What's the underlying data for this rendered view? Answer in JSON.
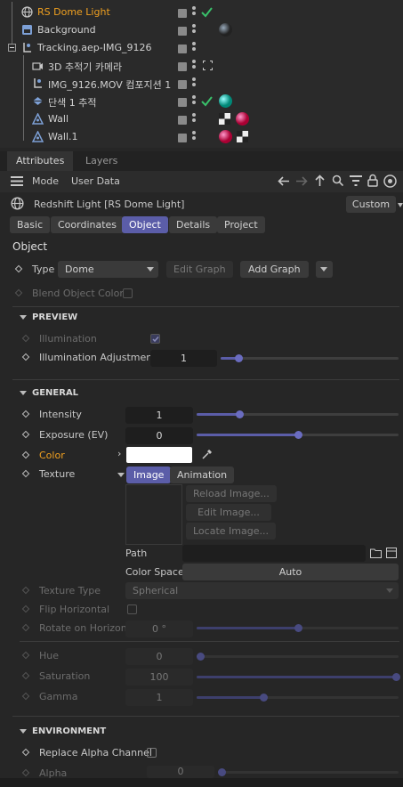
{
  "object_manager": {
    "rows": [
      {
        "name": "RS Dome Light",
        "selected": true
      },
      {
        "name": "Background"
      },
      {
        "name": "Tracking.aep-IMG_9126"
      },
      {
        "name": "3D 추적기 카메라"
      },
      {
        "name": "IMG_9126.MOV 컴포지션 1"
      },
      {
        "name": "단색 1 추적"
      },
      {
        "name": "Wall"
      },
      {
        "name": "Wall.1"
      }
    ]
  },
  "tabs": [
    "Attributes",
    "Layers"
  ],
  "toolbar": {
    "mode_label": "Mode",
    "user_data_label": "User Data"
  },
  "object_header": {
    "title": "Redshift Light [RS Dome Light]",
    "preset": "Custom",
    "tabs": [
      "Basic",
      "Coordinates",
      "Object",
      "Details",
      "Project"
    ],
    "active_tab": "Object",
    "section_title": "Object"
  },
  "type_row": {
    "label": "Type",
    "value": "Dome",
    "edit_graph": "Edit Graph",
    "add_graph": "Add Graph"
  },
  "blend_object_color": "Blend Object Color",
  "preview": {
    "title": "PREVIEW",
    "illumination_label": "Illumination",
    "illumination_adjustment_label": "Illumination Adjustment",
    "illumination_adjustment_value": "1",
    "illumination_adjustment_slider": 0.1
  },
  "general": {
    "title": "GENERAL",
    "intensity_label": "Intensity",
    "intensity_value": "1",
    "intensity_slider": 0.21,
    "exposure_label": "Exposure (EV)",
    "exposure_value": "0",
    "exposure_slider": 0.5,
    "color_label": "Color",
    "color_swatch": "#ffffff",
    "texture_label": "Texture",
    "texture_tabs": [
      "Image",
      "Animation"
    ],
    "reload_image": "Reload Image...",
    "edit_image": "Edit Image...",
    "locate_image": "Locate Image...",
    "path_label": "Path",
    "path_value": "",
    "color_space_label": "Color Space",
    "color_space_value": "Auto",
    "texture_type_label": "Texture Type",
    "texture_type_value": "Spherical",
    "flip_horizontal_label": "Flip Horizontal",
    "rotate_label": "Rotate on Horizon",
    "rotate_value": "0 °",
    "rotate_slider": 0.5,
    "hue_label": "Hue",
    "hue_value": "0",
    "hue_slider": 0.0,
    "saturation_label": "Saturation",
    "saturation_value": "100",
    "saturation_slider": 1.0,
    "gamma_label": "Gamma",
    "gamma_value": "1",
    "gamma_slider": 0.33
  },
  "environment": {
    "title": "ENVIRONMENT",
    "replace_alpha_label": "Replace Alpha Channel",
    "alpha_label": "Alpha",
    "alpha_value": "0"
  },
  "colors": {
    "accent": "#5b5da8",
    "selected_text": "#f0a020",
    "color_label": "#f0a020",
    "check_green": "#39c06a"
  }
}
